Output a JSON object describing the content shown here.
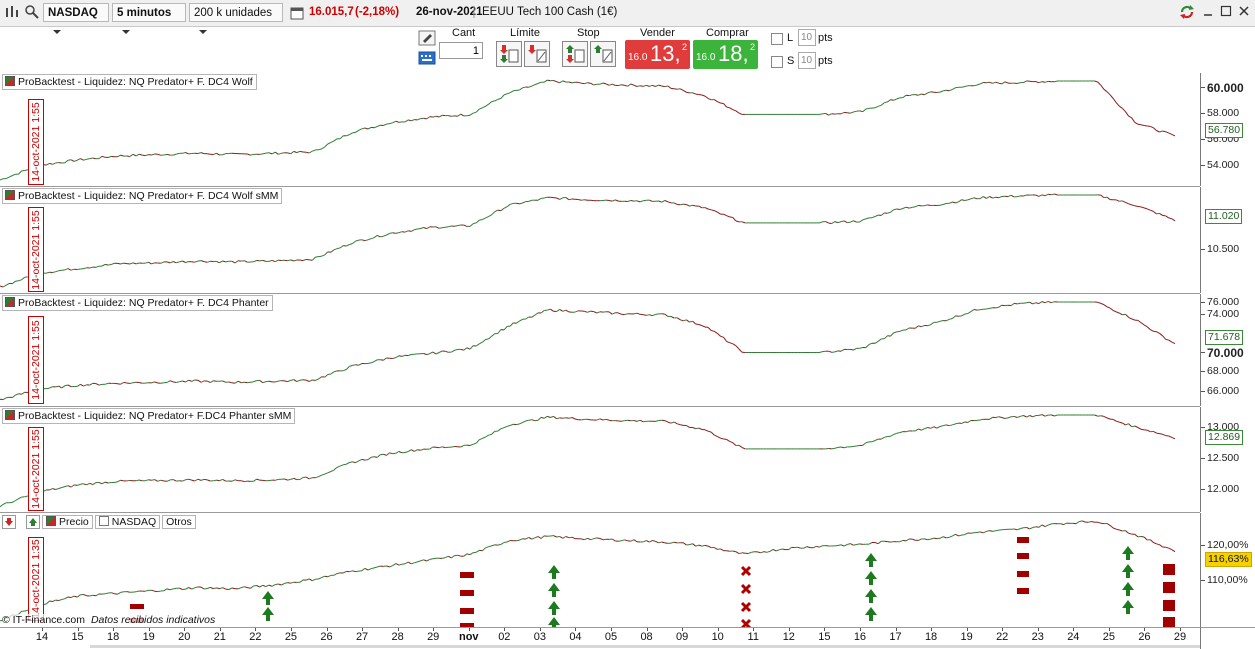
{
  "toolbar": {
    "instrument": "NASDAQ",
    "timeframe": "5 minutos",
    "units": "200 k unidades",
    "price": "16.015,7",
    "change": "(-2,18%)",
    "date": "26-nov-2021",
    "description": "EEUU Tech 100 Cash (1€)"
  },
  "order": {
    "qty_label": "Cant",
    "qty_value": "1",
    "limit_label": "Límite",
    "stop_label": "Stop",
    "sell_label": "Vender",
    "buy_label": "Comprar",
    "sell_prefix": "16.0",
    "sell_big": "13,",
    "sell_sup": "2",
    "buy_prefix": "16.0",
    "buy_big": "18,",
    "buy_sup": "2",
    "long_label": "L",
    "short_label": "S",
    "long_pts": "10",
    "short_pts": "10",
    "pts_label": "pts",
    "colors": {
      "sell": "#e03c3c",
      "buy": "#3cb43c"
    }
  },
  "panels": [
    {
      "title": "ProBacktest - Liquidez: NQ Predator+ F. DC4 Wolf",
      "date_tag": "14-oct-2021 1:55",
      "ticks": [
        "60.000",
        "58.000",
        "56.000",
        "54.000"
      ],
      "last_value": "56.780"
    },
    {
      "title": "ProBacktest - Liquidez: NQ Predator+ F. DC4 Wolf sMM",
      "date_tag": "14-oct-2021 1:55",
      "ticks": [
        "10.500"
      ],
      "last_value": "11.020"
    },
    {
      "title": "ProBacktest - Liquidez: NQ Predator+ F. DC4 Phanter",
      "date_tag": "14-oct-2021 1:55",
      "ticks": [
        "76.000",
        "74.000",
        "70.000",
        "68.000",
        "66.000"
      ],
      "last_value": "71.678"
    },
    {
      "title": "ProBacktest - Liquidez: NQ Predator+ F.DC4 Phanter sMM",
      "date_tag": "14-oct-2021 1:55",
      "ticks": [
        "13.000",
        "12.500",
        "12.000"
      ],
      "last_value": "12.869"
    }
  ],
  "price_panel": {
    "legend_precio": "Precio",
    "legend_nasdaq": "NASDAQ",
    "legend_otros": "Otros",
    "date_tag": "14-oct-2021 1:35",
    "ticks": [
      "120,00%",
      "110,00%"
    ],
    "last_value": "116,63%",
    "footer": "© IT-Finance.com",
    "footer_note": "Datos recibidos indicativos"
  },
  "xaxis": [
    "14",
    "15",
    "18",
    "19",
    "20",
    "21",
    "22",
    "25",
    "26",
    "27",
    "28",
    "29",
    "nov",
    "02",
    "03",
    "04",
    "05",
    "08",
    "09",
    "10",
    "11",
    "12",
    "15",
    "16",
    "17",
    "18",
    "19",
    "22",
    "23",
    "24",
    "25",
    "26",
    "29"
  ],
  "chart_data": {
    "type": "line",
    "title": "",
    "xlabel": "",
    "ylabel": "",
    "series": [
      {
        "name": "ProBacktest - Liquidez: NQ Predator+ F. DC4 Wolf",
        "values": [
          53500,
          54600,
          55000,
          55300,
          55400,
          55500,
          55400,
          55500,
          55600,
          57100,
          57800,
          58200,
          58400,
          60000,
          60900,
          60700,
          60600,
          60500,
          59800,
          58400,
          58400,
          58400,
          58600,
          59700,
          60100,
          60700,
          60800,
          60900,
          60900,
          57800,
          56780
        ]
      },
      {
        "name": "ProBacktest - Liquidez: NQ Predator+ F. DC4 Wolf sMM",
        "values": [
          10300,
          10450,
          10500,
          10550,
          10560,
          10580,
          10570,
          10580,
          10600,
          10780,
          10880,
          10940,
          10960,
          11180,
          11260,
          11240,
          11230,
          11220,
          11150,
          10990,
          10990,
          10990,
          11010,
          11150,
          11190,
          11260,
          11280,
          11290,
          11290,
          11180,
          11020
        ]
      },
      {
        "name": "ProBacktest - Liquidez: NQ Predator+ F. DC4 Phanter",
        "values": [
          66000,
          67100,
          67500,
          67700,
          67800,
          67900,
          67800,
          67900,
          68000,
          69400,
          70300,
          70700,
          71200,
          73500,
          75100,
          74900,
          74700,
          74600,
          73500,
          70800,
          70800,
          70800,
          71200,
          73000,
          73900,
          75200,
          75700,
          75900,
          75900,
          74100,
          71678
        ]
      },
      {
        "name": "ProBacktest - Liquidez: NQ Predator+ F.DC4 Phanter sMM",
        "values": [
          11900,
          12100,
          12200,
          12250,
          12260,
          12270,
          12260,
          12270,
          12300,
          12520,
          12650,
          12720,
          12760,
          13050,
          13160,
          13130,
          13110,
          13100,
          12980,
          12710,
          12710,
          12710,
          12760,
          12950,
          13020,
          13130,
          13170,
          13190,
          13190,
          13020,
          12869
        ]
      },
      {
        "name": "NASDAQ",
        "values": [
          104,
          107,
          108.5,
          109,
          109.5,
          110,
          109.8,
          110.5,
          111.5,
          113,
          114,
          115,
          116,
          118.5,
          119.2,
          118.8,
          118.5,
          118.2,
          117.5,
          116,
          117,
          117.5,
          117.8,
          118.5,
          119,
          120,
          120.5,
          121.5,
          122,
          119.5,
          116.63
        ]
      }
    ],
    "grid": false,
    "legend": "top-left"
  }
}
